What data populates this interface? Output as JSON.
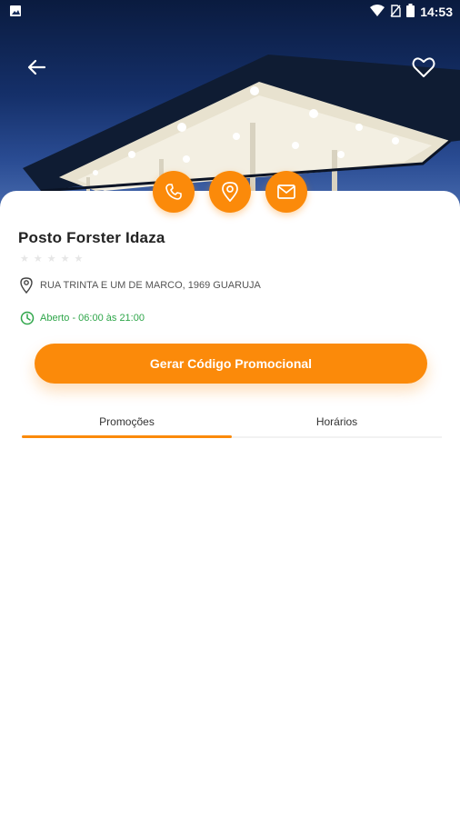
{
  "status_bar": {
    "time": "14:53",
    "icons": [
      "image-notification-icon",
      "wifi-icon",
      "no-sim-icon",
      "battery-icon"
    ]
  },
  "header": {
    "back_icon": "arrow-left-icon",
    "favorite_icon": "heart-outline-icon"
  },
  "actions": [
    {
      "name": "call",
      "icon": "phone-icon"
    },
    {
      "name": "location",
      "icon": "map-pin-icon"
    },
    {
      "name": "email",
      "icon": "envelope-icon"
    }
  ],
  "station": {
    "name": "Posto Forster Idaza",
    "rating": 0,
    "rating_max": 5,
    "address": "RUA TRINTA E UM DE MARCO, 1969 GUARUJA",
    "hours": "Aberto - 06:00 às 21:00"
  },
  "promo_button": {
    "label": "Gerar Código Promocional"
  },
  "tabs": [
    {
      "label": "Promoções",
      "active": true
    },
    {
      "label": "Horários",
      "active": false
    }
  ],
  "colors": {
    "accent": "#fb8a0a",
    "open_status": "#2fa64a",
    "text": "#222222"
  }
}
